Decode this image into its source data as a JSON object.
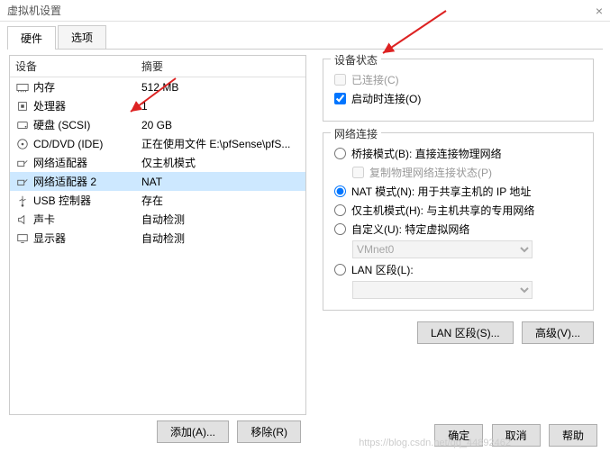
{
  "window": {
    "title": "虚拟机设置"
  },
  "tabs": {
    "hardware": "硬件",
    "options": "选项"
  },
  "columns": {
    "device": "设备",
    "summary": "摘要"
  },
  "devices": [
    {
      "icon": "memory",
      "name": "内存",
      "summary": "512 MB"
    },
    {
      "icon": "cpu",
      "name": "处理器",
      "summary": "1"
    },
    {
      "icon": "disk",
      "name": "硬盘 (SCSI)",
      "summary": "20 GB"
    },
    {
      "icon": "cd",
      "name": "CD/DVD (IDE)",
      "summary": "正在使用文件 E:\\pfSense\\pfS..."
    },
    {
      "icon": "net",
      "name": "网络适配器",
      "summary": "仅主机模式"
    },
    {
      "icon": "net",
      "name": "网络适配器 2",
      "summary": "NAT",
      "selected": true
    },
    {
      "icon": "usb",
      "name": "USB 控制器",
      "summary": "存在"
    },
    {
      "icon": "sound",
      "name": "声卡",
      "summary": "自动检测"
    },
    {
      "icon": "display",
      "name": "显示器",
      "summary": "自动检测"
    }
  ],
  "leftButtons": {
    "add": "添加(A)...",
    "remove": "移除(R)"
  },
  "status": {
    "title": "设备状态",
    "connected": "已连接(C)",
    "connectAtPowerOn": "启动时连接(O)"
  },
  "network": {
    "title": "网络连接",
    "bridged": "桥接模式(B): 直接连接物理网络",
    "replicate": "复制物理网络连接状态(P)",
    "nat": "NAT 模式(N): 用于共享主机的 IP 地址",
    "hostonly": "仅主机模式(H): 与主机共享的专用网络",
    "custom": "自定义(U): 特定虚拟网络",
    "vmnet": "VMnet0",
    "lan": "LAN 区段(L):"
  },
  "rightButtons": {
    "lan": "LAN 区段(S)...",
    "advanced": "高级(V)..."
  },
  "bottom": {
    "ok": "确定",
    "cancel": "取消",
    "help": "帮助"
  },
  "watermark": "https://blog.csdn.net/qq_44892462"
}
